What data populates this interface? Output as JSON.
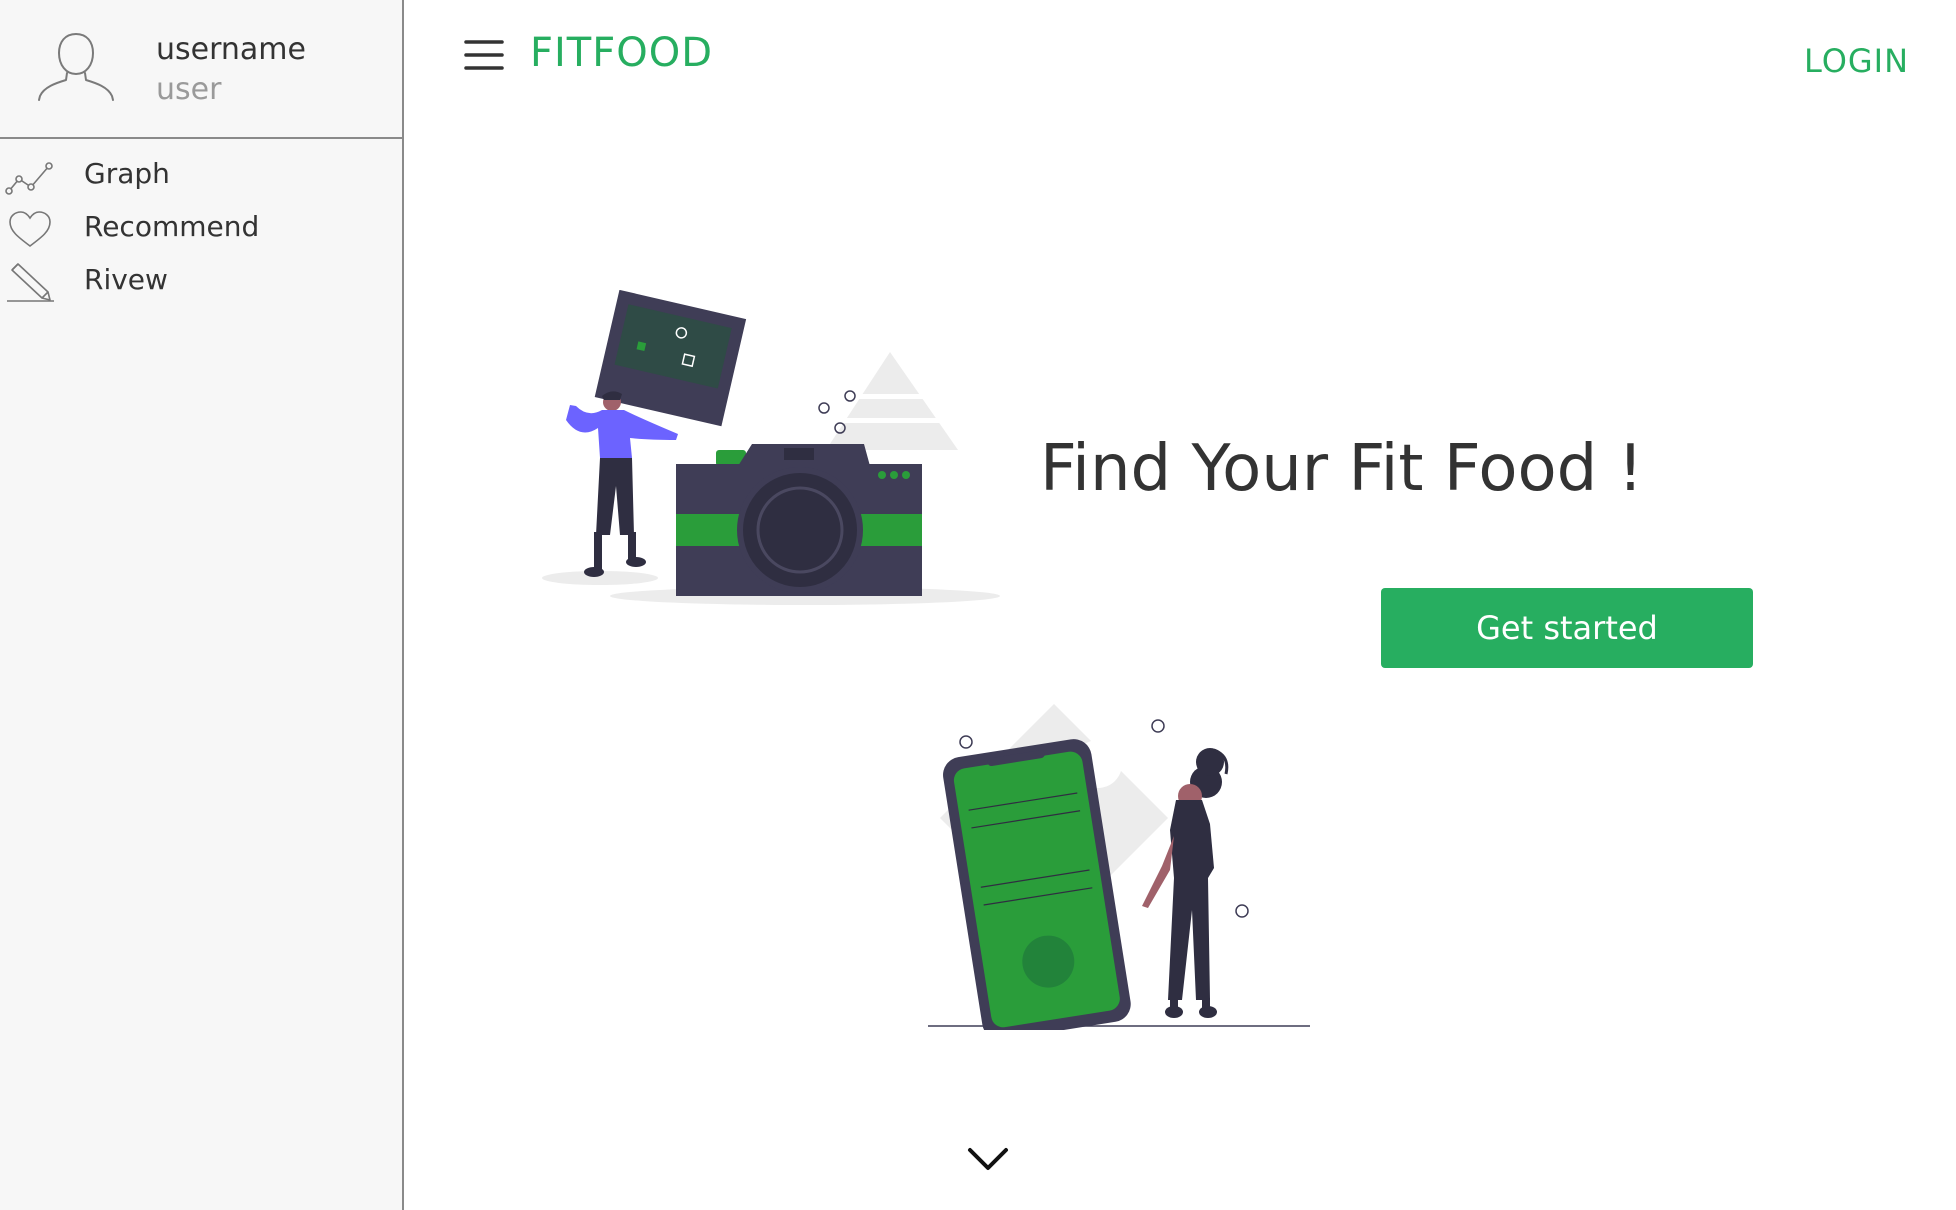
{
  "profile": {
    "name": "username",
    "role": "user"
  },
  "sidebar": {
    "items": [
      {
        "label": "Graph",
        "icon": "graph-icon"
      },
      {
        "label": "Recommend",
        "icon": "heart-icon"
      },
      {
        "label": "Rivew",
        "icon": "pencil-icon"
      }
    ]
  },
  "header": {
    "brand": "FITFOOD",
    "login_label": "LOGIN"
  },
  "hero": {
    "title": "Find Your Fit Food !",
    "cta_label": "Get started"
  },
  "colors": {
    "accent": "#27ae60",
    "illustration_dark": "#3f3d56",
    "illustration_green": "#2a9d3a",
    "illustration_purple": "#6c63ff"
  },
  "icons": {
    "menu": "hamburger-menu-icon",
    "scroll": "chevron-down-icon",
    "avatar": "user-avatar-icon"
  }
}
